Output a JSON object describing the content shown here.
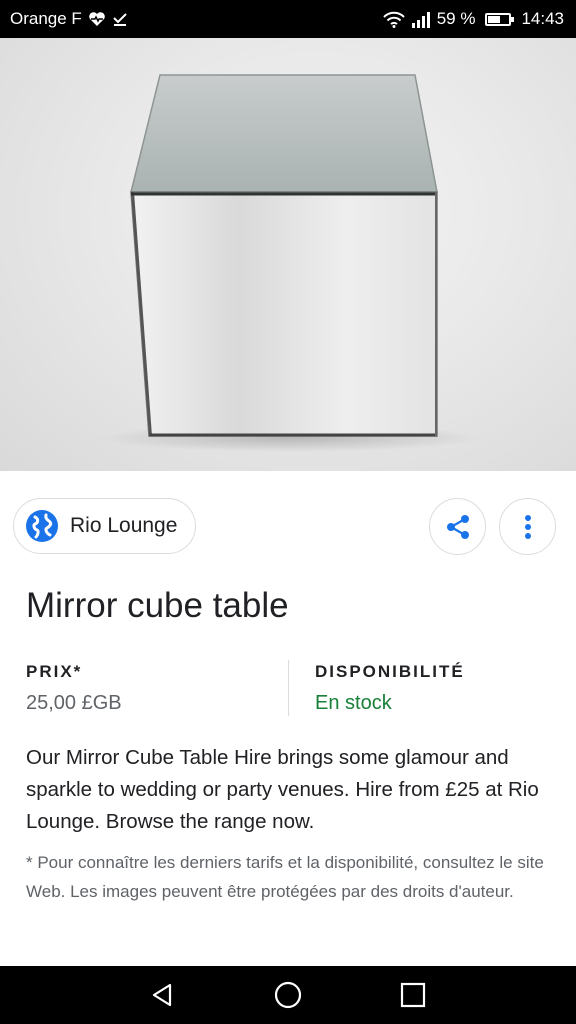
{
  "status_bar": {
    "carrier": "Orange F",
    "battery_percent": "59 %",
    "battery_level": 0.59,
    "time": "14:43",
    "icons": [
      "heart-monitor-icon",
      "check-download-icon",
      "wifi-icon",
      "signal-icon",
      "battery-icon"
    ]
  },
  "source": {
    "name": "Rio Lounge",
    "icon": "globe-icon"
  },
  "actions": {
    "share_icon": "share-icon",
    "more_icon": "more-vert-icon"
  },
  "product": {
    "title": "Mirror cube table",
    "price_label": "PRIX*",
    "price_value": "25,00 £GB",
    "availability_label": "DISPONIBILITÉ",
    "availability_value": "En stock",
    "description": "Our Mirror Cube Table Hire brings some glamour and sparkle to wedding or party venues. Hire from £25 at Rio Lounge. Browse the range now.",
    "disclaimer": "* Pour connaître les derniers tarifs et la disponibilité, consultez le site Web. Les images peuvent être protégées par des droits d'auteur."
  },
  "colors": {
    "accent_blue": "#1a73e8",
    "in_stock_green": "#188038"
  },
  "nav_bar": {
    "icons": [
      "back-icon",
      "home-icon",
      "recents-icon"
    ]
  }
}
